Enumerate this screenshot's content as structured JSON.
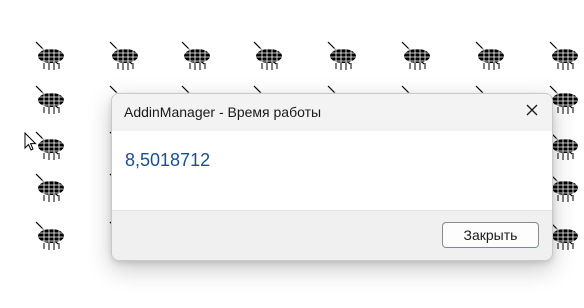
{
  "dialog": {
    "title": "AddinManager - Время работы",
    "message": "8,5018712",
    "ok_button_label": "Закрыть",
    "close_icon": "close-icon"
  },
  "background": {
    "glyph_icon": "hatched-blob-icon"
  },
  "colors": {
    "message_text": "#1f4e8c",
    "titlebar_bg": "#f3f3f3",
    "footer_bg": "#f0f0f0"
  }
}
